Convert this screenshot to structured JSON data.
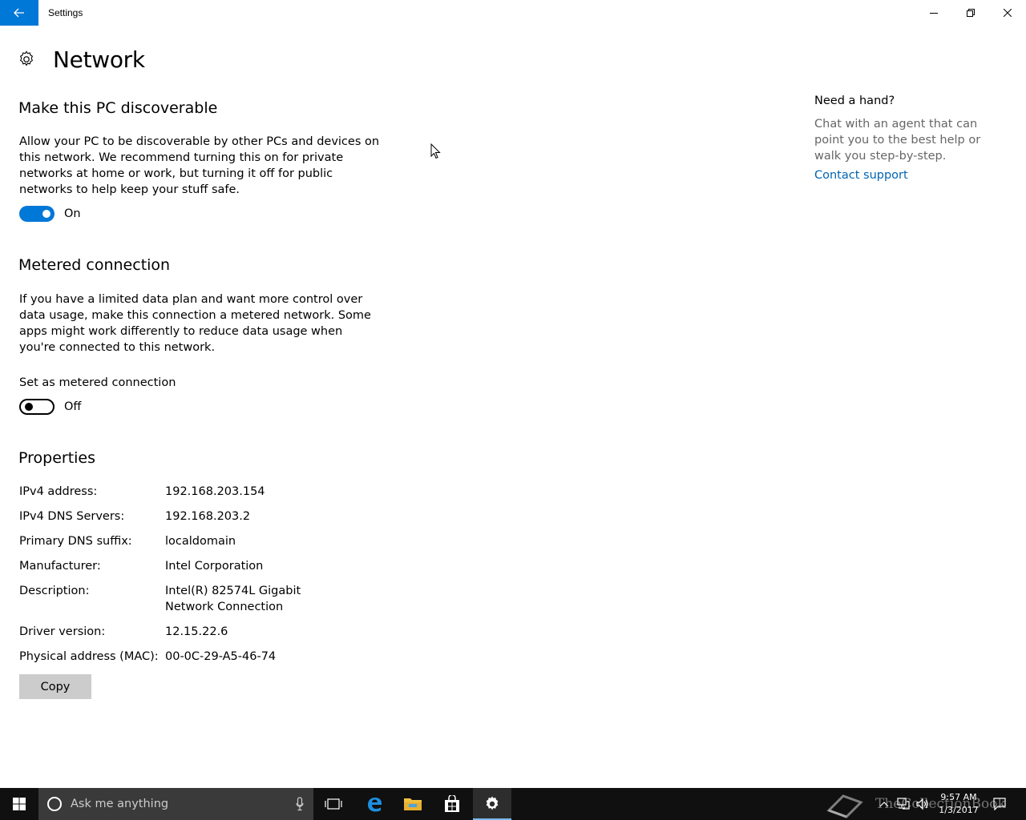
{
  "window": {
    "app_title": "Settings"
  },
  "header": {
    "title": "Network"
  },
  "discoverable": {
    "title": "Make this PC discoverable",
    "description": "Allow your PC to be discoverable by other PCs and devices on this network. We recommend turning this on for private networks at home or work, but turning it off for public networks to help keep your stuff safe.",
    "toggle_state": "On"
  },
  "metered": {
    "title": "Metered connection",
    "description": "If you have a limited data plan and want more control over data usage, make this connection a metered network. Some apps might work differently to reduce data usage when you're connected to this network.",
    "setting_label": "Set as metered connection",
    "toggle_state": "Off"
  },
  "properties": {
    "title": "Properties",
    "rows": [
      {
        "key": "IPv4 address:",
        "value": "192.168.203.154"
      },
      {
        "key": "IPv4 DNS Servers:",
        "value": "192.168.203.2"
      },
      {
        "key": "Primary DNS suffix:",
        "value": "localdomain"
      },
      {
        "key": "Manufacturer:",
        "value": "Intel Corporation"
      },
      {
        "key": "Description:",
        "value": "Intel(R) 82574L Gigabit Network Connection"
      },
      {
        "key": "Driver version:",
        "value": "12.15.22.6"
      },
      {
        "key": "Physical address (MAC):",
        "value": "00-0C-29-A5-46-74"
      }
    ],
    "copy_label": "Copy"
  },
  "help": {
    "title": "Need a hand?",
    "text": "Chat with an agent that can point you to the best help or walk you step-by-step.",
    "link": "Contact support"
  },
  "taskbar": {
    "search_placeholder": "Ask me anything",
    "time": "9:57 AM",
    "date": "1/3/2017",
    "watermark": "TheCollectionBook"
  },
  "colors": {
    "accent": "#0078d7",
    "link": "#0063b1",
    "taskbar": "#101010"
  }
}
